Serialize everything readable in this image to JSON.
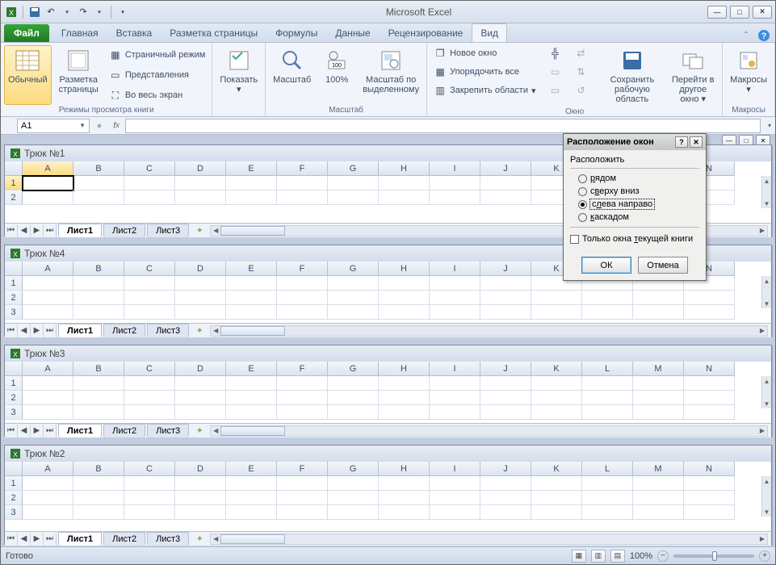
{
  "app": {
    "title": "Microsoft Excel"
  },
  "tabs": {
    "file": "Файл",
    "items": [
      "Главная",
      "Вставка",
      "Разметка страницы",
      "Формулы",
      "Данные",
      "Рецензирование",
      "Вид"
    ],
    "active": "Вид"
  },
  "ribbon": {
    "view_modes": {
      "normal": "Обычный",
      "page_layout": "Разметка\nстраницы",
      "group_label": "Режимы просмотра книги",
      "page_break": "Страничный режим",
      "custom_views": "Представления",
      "full_screen": "Во весь экран"
    },
    "show": {
      "btn": "Показать"
    },
    "zoom": {
      "zoom": "Масштаб",
      "hundred": "100%",
      "to_selection": "Масштаб по\nвыделенному",
      "group_label": "Масштаб"
    },
    "window": {
      "new_window": "Новое окно",
      "arrange": "Упорядочить все",
      "freeze": "Закрепить области",
      "save_workspace": "Сохранить\nрабочую область",
      "switch_windows": "Перейти в\nдругое окно",
      "group_label": "Окно"
    },
    "macros": {
      "btn": "Макросы",
      "group_label": "Макросы"
    }
  },
  "formula_bar": {
    "name_box": "A1"
  },
  "workbooks": [
    {
      "title": "Трюк №1",
      "selected_cell": "A1"
    },
    {
      "title": "Трюк №4"
    },
    {
      "title": "Трюк №3"
    },
    {
      "title": "Трюк №2"
    }
  ],
  "columns": [
    "A",
    "B",
    "C",
    "D",
    "E",
    "F",
    "G",
    "H",
    "I",
    "J",
    "K",
    "L",
    "M",
    "N"
  ],
  "rows_short": [
    "1",
    "2"
  ],
  "rows_mid": [
    "1",
    "2",
    "3"
  ],
  "sheet_tabs": [
    "Лист1",
    "Лист2",
    "Лист3"
  ],
  "dialog": {
    "title": "Расположение окон",
    "group": "Расположить",
    "options": [
      {
        "label": "рядом",
        "accel": "р"
      },
      {
        "label": "сверху вниз",
        "accel": "в"
      },
      {
        "label": "слева направо",
        "accel": "л"
      },
      {
        "label": "каскадом",
        "accel": "к"
      }
    ],
    "selected": 2,
    "checkbox": "Только окна текущей книги",
    "checkbox_accel": "т",
    "ok": "ОК",
    "cancel": "Отмена"
  },
  "status": {
    "ready": "Готово",
    "zoom": "100%"
  }
}
